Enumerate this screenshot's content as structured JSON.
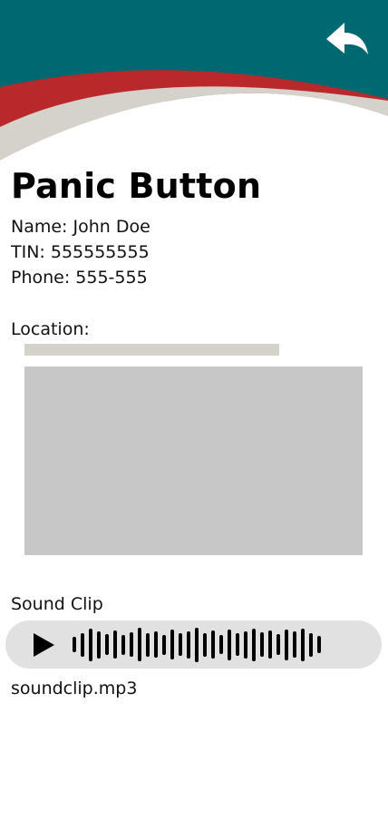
{
  "header": {
    "colors": {
      "teal": "#006870",
      "red": "#b9282b",
      "beige": "#d5d1cb"
    },
    "back_icon": "reply-arrow-icon"
  },
  "page": {
    "title": "Panic Button"
  },
  "person": {
    "name_line": "Name: John Doe",
    "tin_line": "TIN: 555555555",
    "phone_line": "Phone: 555-555"
  },
  "location": {
    "label": "Location:"
  },
  "sound": {
    "label": "Sound Clip",
    "play_icon": "play-icon",
    "file_name": "soundclip.mp3",
    "waveform_levels": [
      0.42,
      0.64,
      0.9,
      0.74,
      0.58,
      0.78,
      0.54,
      0.68,
      0.92,
      0.66,
      0.72,
      0.54,
      0.82,
      0.62,
      0.74,
      0.94,
      0.66,
      0.78,
      0.52,
      0.86,
      0.62,
      0.74,
      0.9,
      0.68,
      0.78,
      0.58,
      0.86,
      0.72,
      0.9,
      0.64,
      0.48
    ]
  }
}
